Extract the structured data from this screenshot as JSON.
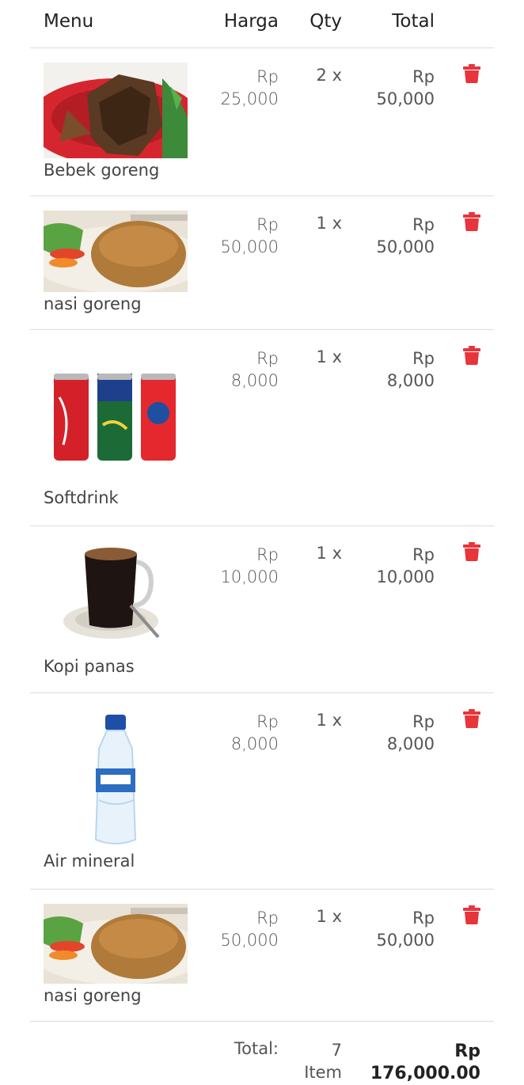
{
  "header": {
    "menu": "Menu",
    "harga": "Harga",
    "qty": "Qty",
    "total": "Total"
  },
  "items": [
    {
      "name": "Bebek goreng",
      "currency": "Rp",
      "price": "25,000",
      "qty": "2 x",
      "total": "50,000",
      "image": "bebek-goreng-image"
    },
    {
      "name": "nasi goreng",
      "currency": "Rp",
      "price": "50,000",
      "qty": "1 x",
      "total": "50,000",
      "image": "nasi-goreng-image"
    },
    {
      "name": "Softdrink",
      "currency": "Rp",
      "price": "8,000",
      "qty": "1 x",
      "total": "8,000",
      "image": "softdrink-image"
    },
    {
      "name": "Kopi panas",
      "currency": "Rp",
      "price": "10,000",
      "qty": "1 x",
      "total": "10,000",
      "image": "kopi-panas-image"
    },
    {
      "name": "Air mineral",
      "currency": "Rp",
      "price": "8,000",
      "qty": "1 x",
      "total": "8,000",
      "image": "air-mineral-image"
    },
    {
      "name": "nasi goreng",
      "currency": "Rp",
      "price": "50,000",
      "qty": "1 x",
      "total": "50,000",
      "image": "nasi-goreng-image"
    }
  ],
  "footer": {
    "label": "Total:",
    "qty": "7",
    "qty_unit": "Item",
    "currency": "Rp",
    "total": "176,000.00"
  },
  "colors": {
    "accent": "#e8343b",
    "separator": "#dcdcdc"
  }
}
